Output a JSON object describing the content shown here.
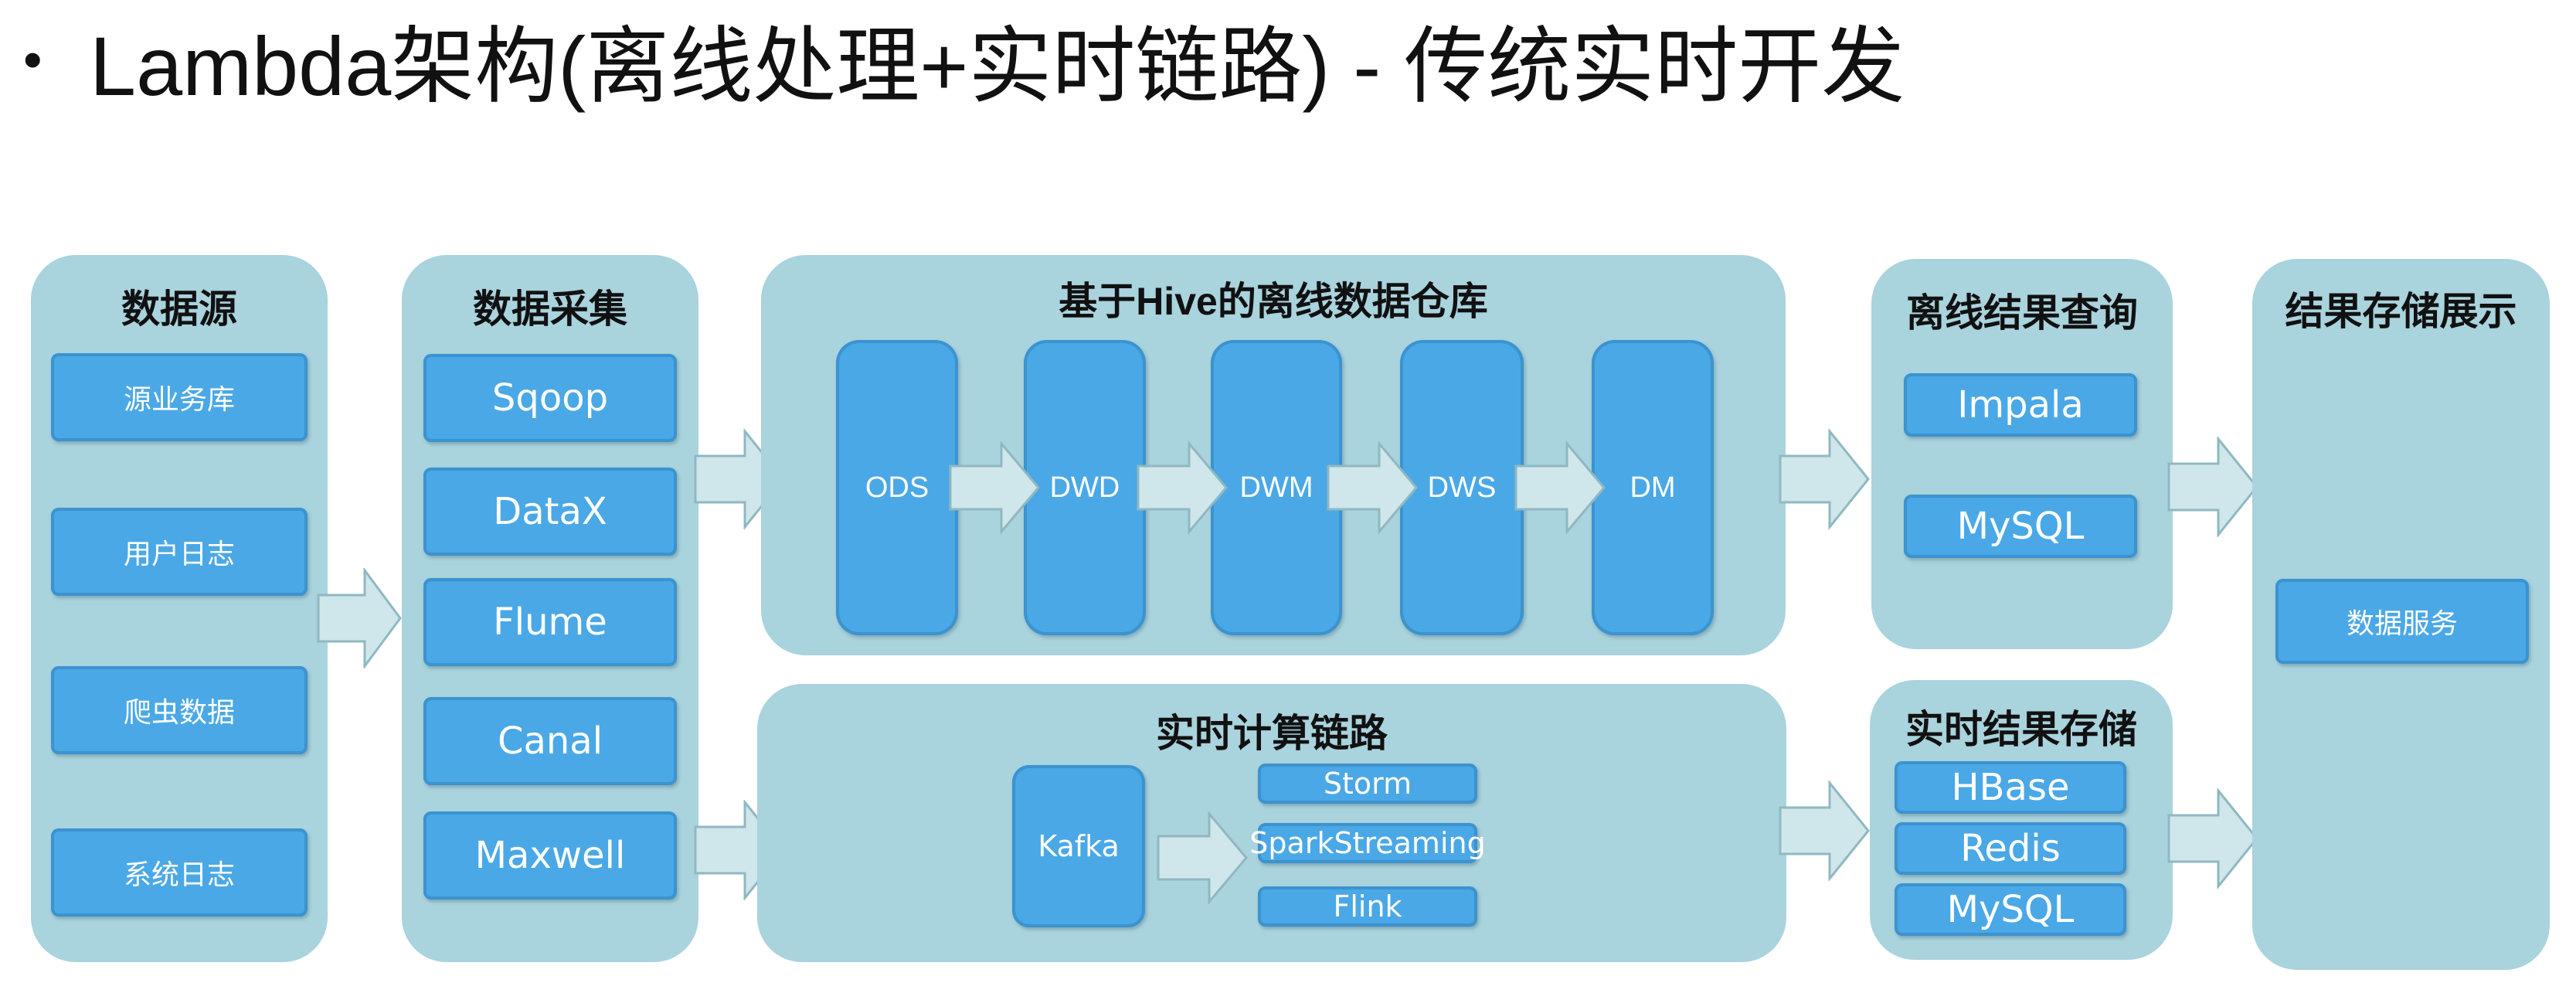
{
  "title": {
    "bullet": "•",
    "text": "Lambda架构(离线处理+实时链路) - 传统实时开发"
  },
  "sources": {
    "title": "数据源",
    "items": [
      "源业务库",
      "用户日志",
      "爬虫数据",
      "系统日志"
    ]
  },
  "collection": {
    "title": "数据采集",
    "items": [
      "Sqoop",
      "DataX",
      "Flume",
      "Canal",
      "Maxwell"
    ]
  },
  "offline_warehouse": {
    "title_prefix": "基于",
    "title_bold": "Hive",
    "title_suffix": "的离线数据仓库",
    "stages": [
      "ODS",
      "DWD",
      "DWM",
      "DWS",
      "DM"
    ]
  },
  "realtime": {
    "title": "实时计算链路",
    "queue": "Kafka",
    "engines": [
      "Storm",
      "SparkStreaming",
      "Flink"
    ]
  },
  "offline_query": {
    "title": "离线结果查询",
    "items": [
      "Impala",
      "MySQL"
    ]
  },
  "realtime_storage": {
    "title": "实时结果存储",
    "items": [
      "HBase",
      "Redis",
      "MySQL"
    ]
  },
  "result_display": {
    "title": "结果存储展示",
    "item": "数据服务"
  },
  "colors": {
    "panel": "#a9d3dd",
    "box": "#4aa8e6",
    "arrow": "#cfe6ea"
  }
}
